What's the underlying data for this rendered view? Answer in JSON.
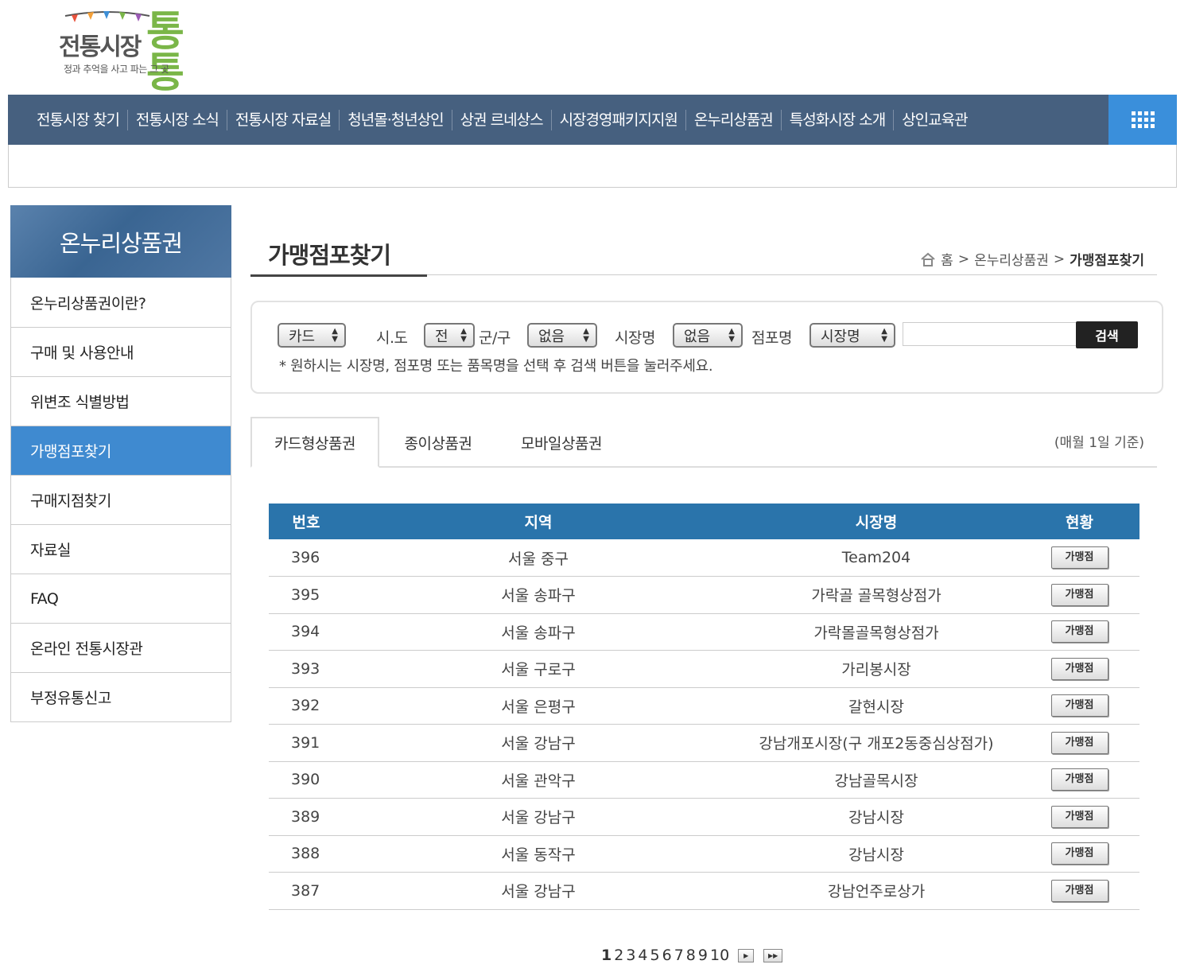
{
  "logo": {
    "title": "전통시장",
    "tong": "통통",
    "slogan": "정과 추억을 사고 파는 그 곳"
  },
  "topnav": {
    "items": [
      "전통시장 찾기",
      "전통시장 소식",
      "전통시장 자료실",
      "청년몰·청년상인",
      "상권 르네상스",
      "시장경영패키지지원",
      "온누리상품권",
      "특성화시장 소개",
      "상인교육관"
    ],
    "menu_icon": "grid-menu-icon"
  },
  "sidebar": {
    "title": "온누리상품권",
    "items": [
      "온누리상품권이란?",
      "구매 및 사용안내",
      "위변조 식별방법",
      "가맹점포찾기",
      "구매지점찾기",
      "자료실",
      "FAQ",
      "온라인 전통시장관",
      "부정유통신고"
    ],
    "active_index": 3
  },
  "page": {
    "title": "가맹점포찾기",
    "breadcrumb": {
      "home": "홈",
      "parent": "온누리상품권",
      "current": "가맹점포찾기",
      "separator": ">"
    }
  },
  "search": {
    "type_select": "카드",
    "sido_label": "시.도",
    "sido_select": "전",
    "gungu_label": "군/구",
    "gungu_select": "없음",
    "market_label": "시장명",
    "market_select": "없음",
    "shop_label": "점포명",
    "field_select": "시장명",
    "input_value": "",
    "button": "검색",
    "hint": "* 원하시는 시장명, 점포명 또는 품목명을 선택 후 검색 버튼을 눌러주세요."
  },
  "tabs": {
    "items": [
      "카드형상품권",
      "종이상품권",
      "모바일상품권"
    ],
    "active_index": 0,
    "note": "(매월 1일 기준)"
  },
  "table": {
    "headers": [
      "번호",
      "지역",
      "시장명",
      "현황"
    ],
    "button_label": "가맹점",
    "rows": [
      [
        "396",
        "서울 중구",
        "Team204"
      ],
      [
        "395",
        "서울 송파구",
        "가락골 골목형상점가"
      ],
      [
        "394",
        "서울 송파구",
        "가락몰골목형상점가"
      ],
      [
        "393",
        "서울 구로구",
        "가리봉시장"
      ],
      [
        "392",
        "서울 은평구",
        "갈현시장"
      ],
      [
        "391",
        "서울 강남구",
        "강남개포시장(구 개포2동중심상점가)"
      ],
      [
        "390",
        "서울 관악구",
        "강남골목시장"
      ],
      [
        "389",
        "서울 강남구",
        "강남시장"
      ],
      [
        "388",
        "서울 동작구",
        "강남시장"
      ],
      [
        "387",
        "서울 강남구",
        "강남언주로상가"
      ]
    ]
  },
  "pagination": {
    "pages": [
      "1",
      "2",
      "3",
      "4",
      "5",
      "6",
      "7",
      "8",
      "9",
      "10"
    ],
    "current": "1",
    "next_icon": "next-page-icon",
    "last_icon": "last-page-icon"
  }
}
